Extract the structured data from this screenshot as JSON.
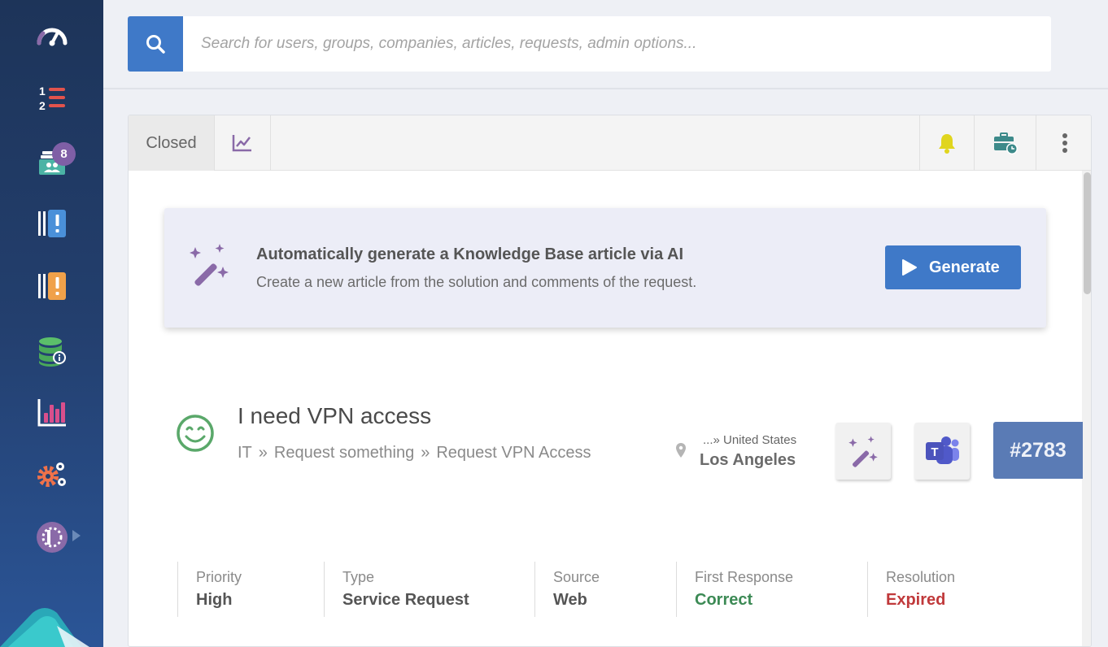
{
  "sidebar": {
    "items": [
      {
        "name": "dashboard",
        "icon": "speedometer-icon"
      },
      {
        "name": "requests-list",
        "icon": "numbered-list-icon"
      },
      {
        "name": "team-requests",
        "icon": "team-cards-icon",
        "badge": "8"
      },
      {
        "name": "incidents",
        "icon": "alert-blue-icon"
      },
      {
        "name": "problems",
        "icon": "alert-orange-icon"
      },
      {
        "name": "cmdb",
        "icon": "database-info-icon"
      },
      {
        "name": "reports",
        "icon": "bar-chart-icon"
      },
      {
        "name": "settings",
        "icon": "gears-icon"
      },
      {
        "name": "user-profile",
        "icon": "user-avatar-icon"
      }
    ]
  },
  "search": {
    "placeholder": "Search for users, groups, companies, articles, requests, admin options..."
  },
  "toolbar": {
    "status_tab": "Closed"
  },
  "ai_card": {
    "title": "Automatically generate a Knowledge Base article via AI",
    "subtitle": "Create a new article from the solution and comments of the request.",
    "button_label": "Generate"
  },
  "request": {
    "title": "I need VPN access",
    "breadcrumb": [
      "IT",
      "Request something",
      "Request VPN Access"
    ],
    "breadcrumb_sep": "»",
    "location_country": "...» United States",
    "location_city": "Los Angeles",
    "ticket_id": "#2783"
  },
  "stats": [
    {
      "label": "Priority",
      "value": "High",
      "color": "#555555"
    },
    {
      "label": "Type",
      "value": "Service Request",
      "color": "#555555"
    },
    {
      "label": "Source",
      "value": "Web",
      "color": "#555555"
    },
    {
      "label": "First Response",
      "value": "Correct",
      "color": "#3c8a55"
    },
    {
      "label": "Resolution",
      "value": "Expired",
      "color": "#c0393b"
    }
  ],
  "colors": {
    "accent": "#3f79c8",
    "purple": "#8a6aa8",
    "ticket": "#5a7bb5",
    "success": "#3c8a55",
    "danger": "#c0393b"
  }
}
